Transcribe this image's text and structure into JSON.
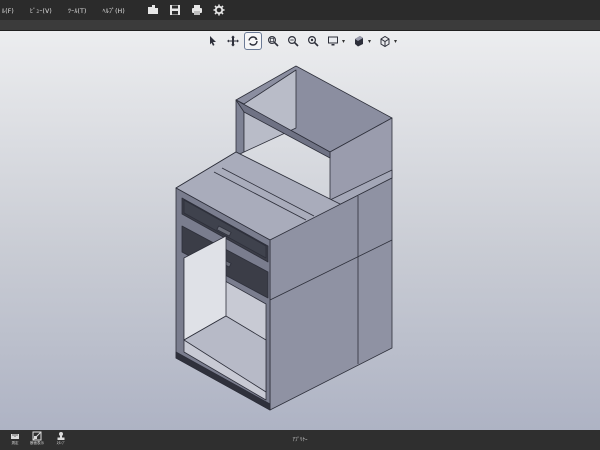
{
  "menubar": {
    "menus": [
      "ﾙ(F)",
      "ﾋﾞｭｰ(V)",
      "ﾂｰﾙ(T)",
      "ﾍﾙﾌﾟ(H)"
    ],
    "tool_icons": [
      "open-folder-icon",
      "save-icon",
      "print-icon",
      "settings-gear-icon"
    ]
  },
  "viewport_toolbar": {
    "tools": [
      "select-arrow-icon",
      "pan-icon",
      "rotate-icon",
      "zoom-window-icon",
      "zoom-icon",
      "zoom-fit-icon",
      "display-monitor-icon",
      "appearance-icon",
      "view-cube-icon"
    ],
    "active_tool": "rotate-icon"
  },
  "bottombar": {
    "buttons": [
      {
        "icon": "measure-icon",
        "label": "測定"
      },
      {
        "icon": "section-icon",
        "label": "断面表示"
      },
      {
        "icon": "stamp-icon",
        "label": "ｽﾀﾝﾌﾟ"
      }
    ],
    "status": "ｱﾌﾟﾘｹｰ"
  },
  "colors": {
    "menubar_bg": "#2b2b2b",
    "viewport_top": "#ecedef",
    "viewport_bottom": "#aeb3c4",
    "model_face": "#9a9cab",
    "drawer_face": "#3b3d47"
  }
}
